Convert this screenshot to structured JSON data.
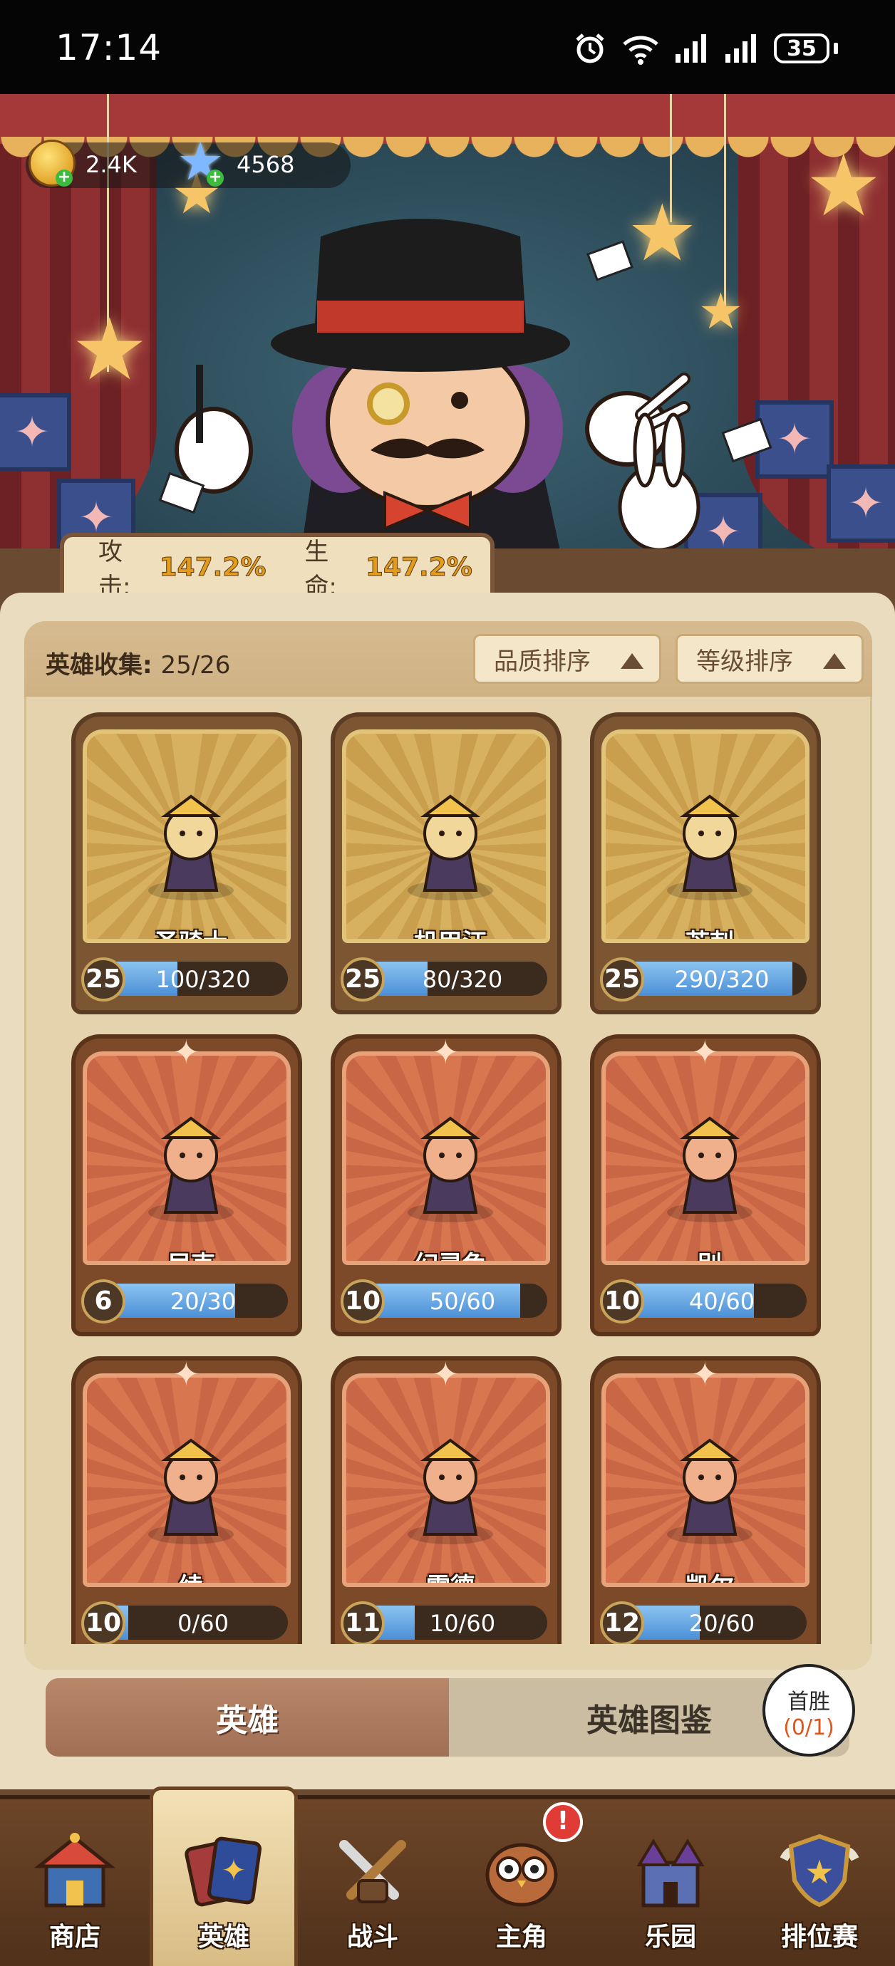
{
  "status_bar": {
    "time": "17:14",
    "battery": "35"
  },
  "currency": {
    "gold": "2.4K",
    "gems": "4568"
  },
  "stats": {
    "attack_label": "攻击:",
    "attack_value": "147.2%",
    "hp_label": "生命:",
    "hp_value": "147.2%"
  },
  "collection": {
    "label": "英雄收集:",
    "count": "25/26"
  },
  "sort": {
    "quality": "品质排序",
    "level": "等级排序"
  },
  "heroes": [
    {
      "name": "圣骑士",
      "level": "25",
      "progress": "100/320",
      "fill": 0.31,
      "rarity": "gold"
    },
    {
      "name": "机甲汪",
      "level": "25",
      "progress": "80/320",
      "fill": 0.25,
      "rarity": "gold"
    },
    {
      "name": "芒刺",
      "level": "25",
      "progress": "290/320",
      "fill": 0.91,
      "rarity": "gold"
    },
    {
      "name": "尼克",
      "level": "6",
      "progress": "20/30",
      "fill": 0.67,
      "rarity": "orange"
    },
    {
      "name": "幻灵兔",
      "level": "10",
      "progress": "50/60",
      "fill": 0.83,
      "rarity": "orange"
    },
    {
      "name": "别",
      "level": "10",
      "progress": "40/60",
      "fill": 0.67,
      "rarity": "orange"
    },
    {
      "name": "绫",
      "level": "10",
      "progress": "0/60",
      "fill": 0.0,
      "rarity": "orange"
    },
    {
      "name": "雷德",
      "level": "11",
      "progress": "10/60",
      "fill": 0.17,
      "rarity": "orange"
    },
    {
      "name": "凯尔",
      "level": "12",
      "progress": "20/60",
      "fill": 0.33,
      "rarity": "orange"
    }
  ],
  "tabs": {
    "heroes": "英雄",
    "compendium": "英雄图鉴"
  },
  "first_win": {
    "label": "首胜",
    "count": "(0/1)"
  },
  "nav": {
    "shop": "商店",
    "heroes": "英雄",
    "battle": "战斗",
    "protagonist": "主角",
    "park": "乐园",
    "ranked": "排位赛"
  },
  "colors": {
    "gold_card": "#d7b15f",
    "orange_card": "#d7764f",
    "progress_fill": "#4b8fd6",
    "alert": "#e13b35"
  }
}
